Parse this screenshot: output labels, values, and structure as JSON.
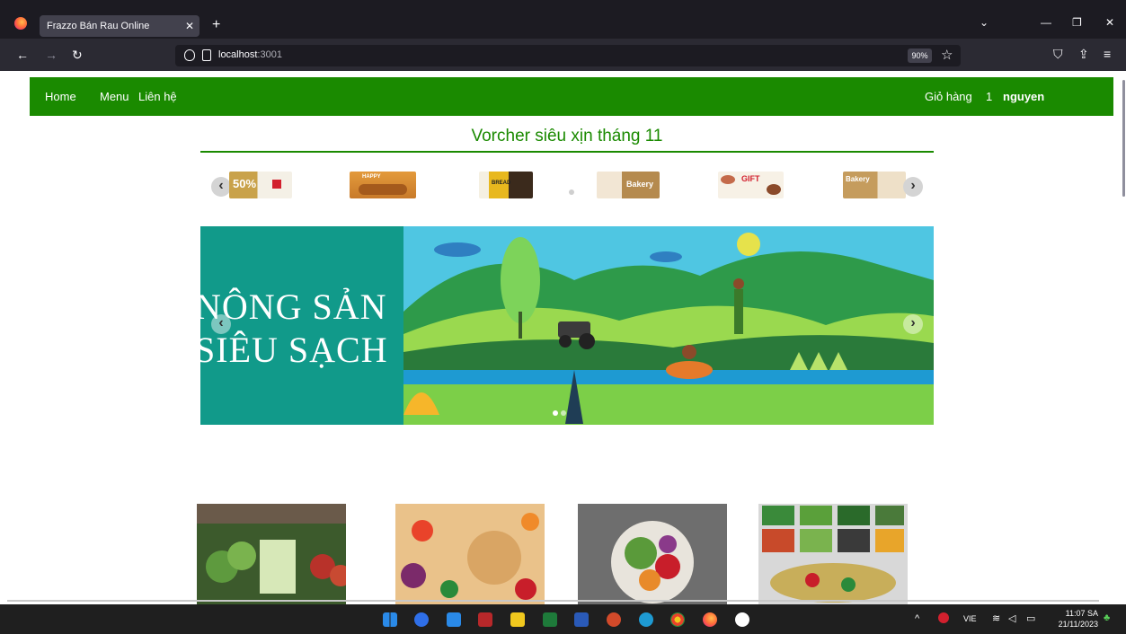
{
  "browser": {
    "tab_title": "Frazzo Bán Rau Online",
    "url_host": "localhost",
    "url_port": ":3001",
    "zoom": "90%"
  },
  "site_nav": {
    "home": "Home",
    "menu": "Menu",
    "contact": "Liên hệ",
    "cart": "Giỏ hàng",
    "cart_count": "1",
    "user": "nguyen"
  },
  "voucher_section": {
    "title": "Vorcher siêu xịn tháng 11",
    "vouchers": [
      {
        "label": "50%",
        "color": "#c9a24a"
      },
      {
        "label": "HAPPY",
        "color": "#d98a2f"
      },
      {
        "label": "BREAD",
        "color": "#e8b81e"
      },
      {
        "label": "Bakery",
        "color": "#c7a067"
      },
      {
        "label": "GIFT",
        "color": "#f0eae0"
      },
      {
        "label": "Bakery",
        "color": "#c59c5d"
      }
    ]
  },
  "hero_banner": {
    "line1": "NÔNG SẢN",
    "line2": "SIÊU SẠCH",
    "accent_color": "#119a8a"
  },
  "taskbar": {
    "language": "VIE",
    "time": "11:07 SA",
    "date": "21/11/2023"
  },
  "colors": {
    "brand_green": "#1a8a00"
  }
}
